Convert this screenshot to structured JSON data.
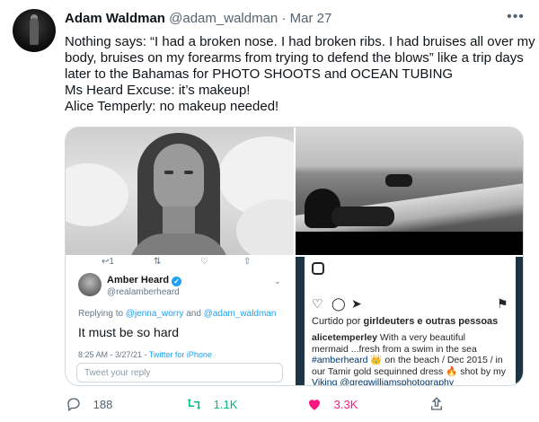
{
  "author": {
    "name": "Adam Waldman",
    "handle": "@adam_waldman",
    "separator": "·",
    "date": "Mar 27"
  },
  "more_icon": "more-horizontal-icon",
  "tweet_lines": [
    "Nothing says: “I had a broken nose. I had broken ribs. I had bruises all over my",
    "body, bruises on my forearms from trying to defend the blows” like a trip days",
    "later to the Bahamas for PHOTO SHOOTS and OCEAN TUBING",
    "Ms Heard Excuse: it’s makeup!",
    "Alice Temperly: no makeup needed!"
  ],
  "embedded_tweet": {
    "action_counts": [
      "1",
      "",
      "",
      ""
    ],
    "name": "Amber Heard",
    "verified_mark": "✓",
    "handle": "@realamberheard",
    "reply_prefix": "Replying to",
    "reply_to_1": "@jenna_worry",
    "reply_and": "and",
    "reply_to_2": "@adam_waldman",
    "text": "It must be so hard",
    "time": "8:25 AM - 3/27/21 -",
    "client": "Twitter for iPhone",
    "reply_placeholder": "Tweet your reply"
  },
  "instagram": {
    "liked_prefix": "Curtido por",
    "liked_user": "girldeuters",
    "liked_suffix": "e outras pessoas",
    "caption_lines": [
      {
        "user": "alicetemperley",
        "text": " With a very beautiful"
      },
      {
        "user": "",
        "text": "mermaid ...fresh from a swim in the sea"
      },
      {
        "user": "#amberheard",
        "text": " 👑 on the beach / Dec 2015 / in"
      },
      {
        "user": "",
        "text": "our Tamir  gold sequinned dress 🔥 shot by my"
      },
      {
        "user": "",
        "text": "Viking  @gregwilliamsphotography"
      }
    ]
  },
  "actions": {
    "reply_count": "188",
    "retweet_count": "1.1K",
    "like_count": "3.3K"
  }
}
